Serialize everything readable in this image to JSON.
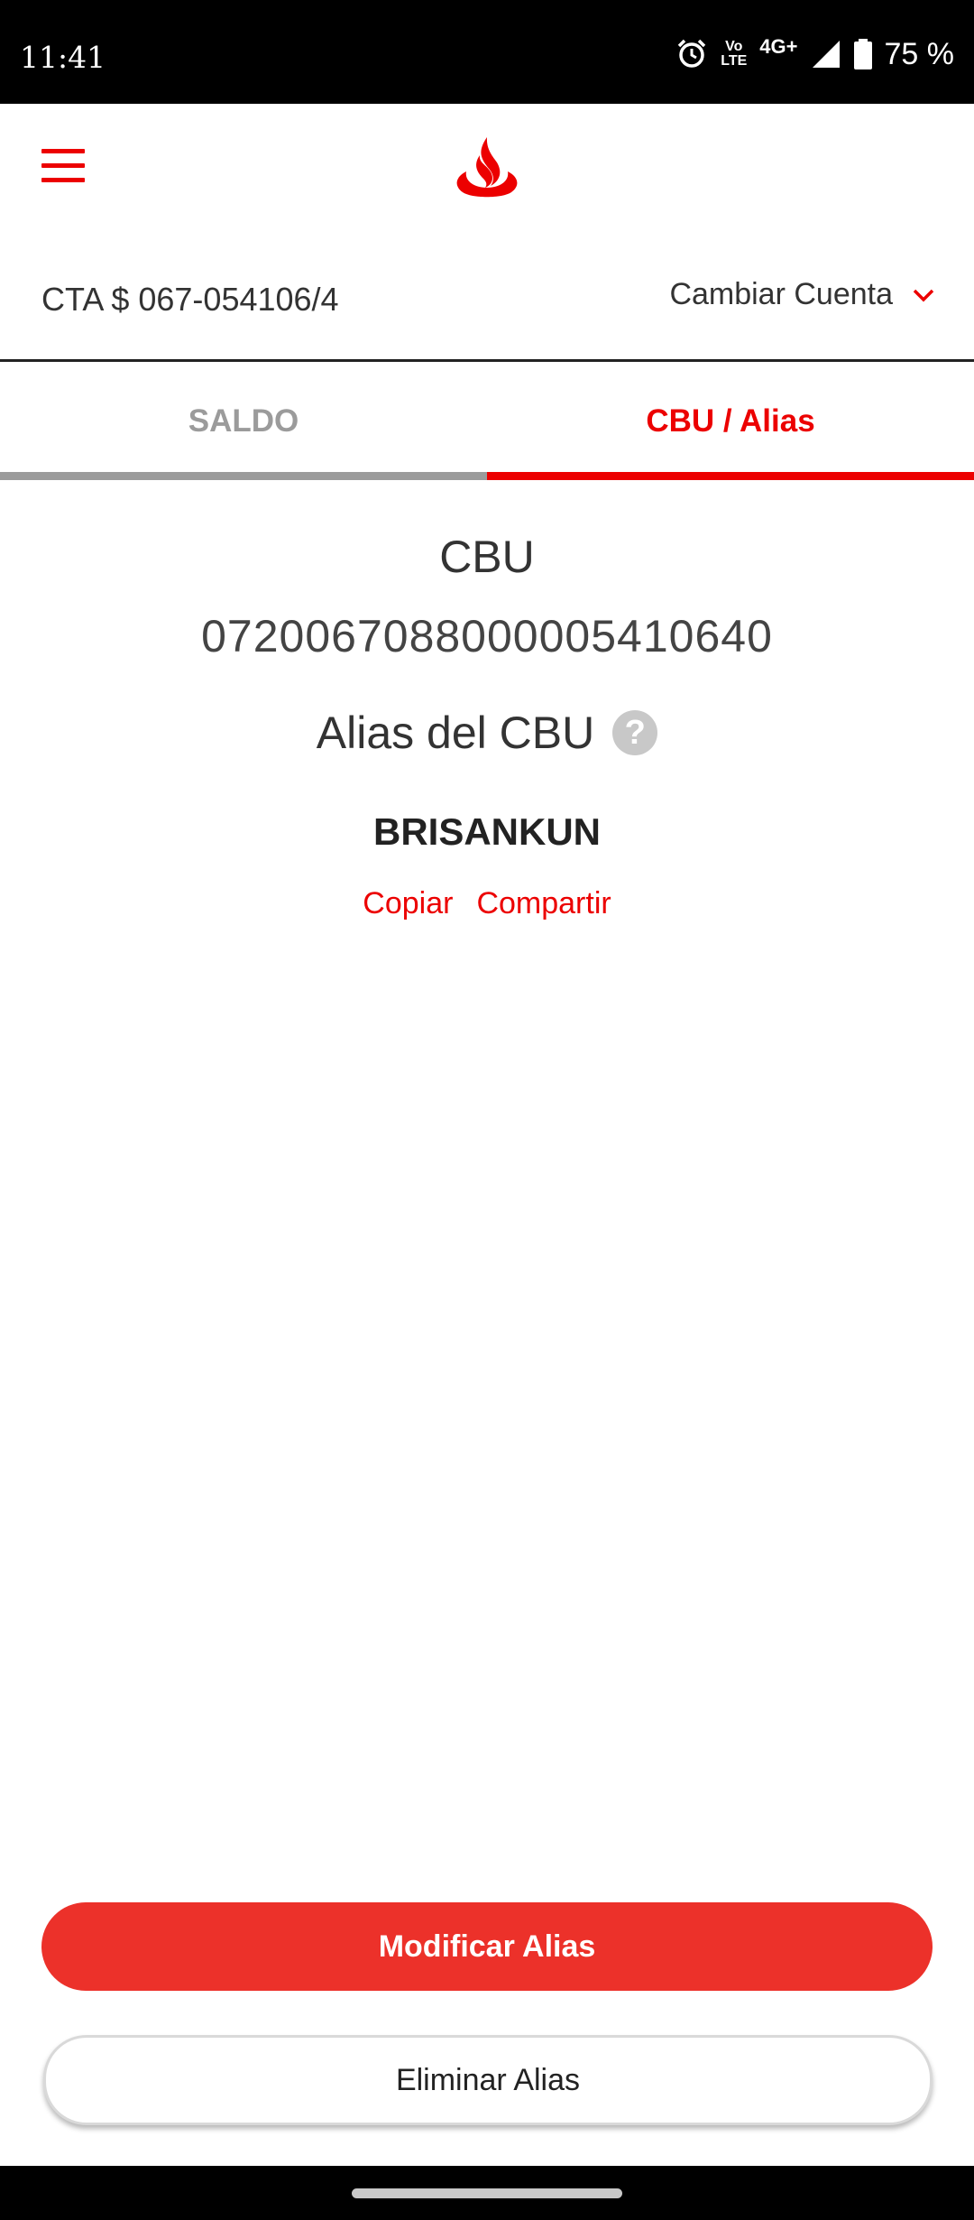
{
  "status_bar": {
    "time": "11:41",
    "network": "4G+",
    "volte_top": "Vo",
    "volte_bottom": "LTE",
    "battery": "75 %"
  },
  "header": {
    "menu_icon": "hamburger-menu-icon",
    "logo_icon": "santander-flame-logo"
  },
  "account": {
    "number": "CTA $ 067-054106/4",
    "change_label": "Cambiar Cuenta",
    "change_icon": "chevron-down-icon"
  },
  "tabs": [
    {
      "label": "SALDO",
      "active": false
    },
    {
      "label": "CBU / Alias",
      "active": true
    }
  ],
  "main": {
    "cbu_title": "CBU",
    "cbu_number": "0720067088000005410640",
    "alias_title": "Alias del CBU",
    "help_glyph": "?",
    "alias_value": "BRISANKUN",
    "copy_label": "Copiar",
    "share_label": "Compartir"
  },
  "buttons": {
    "modify_label": "Modificar Alias",
    "delete_label": "Eliminar Alias"
  },
  "colors": {
    "accent": "#ec0000",
    "primary_button": "#ec312a",
    "inactive_tab": "#9b9b9b"
  }
}
